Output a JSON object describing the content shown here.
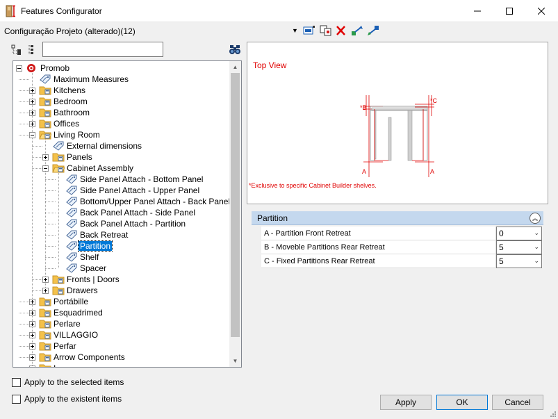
{
  "window": {
    "title": "Features Configurator",
    "minimize_icon": "minimize-icon",
    "maximize_icon": "maximize-icon",
    "close_icon": "close-icon"
  },
  "project": {
    "name": "Configuração Projeto (alterado)(12)",
    "toolbar_icons": [
      "project-dropdown-icon",
      "edit-project-icon",
      "copy-project-icon",
      "delete-icon",
      "export-icon",
      "import-icon"
    ]
  },
  "search": {
    "value": "",
    "placeholder": ""
  },
  "tree": {
    "items": [
      {
        "label": "Promob",
        "icon": "promob-logo-icon"
      },
      {
        "label": "Maximum Measures",
        "icon": "tag-icon"
      },
      {
        "label": "Kitchens",
        "icon": "folder-icon"
      },
      {
        "label": "Bedroom",
        "icon": "folder-icon"
      },
      {
        "label": "Bathroom",
        "icon": "folder-icon"
      },
      {
        "label": "Offices",
        "icon": "folder-icon"
      },
      {
        "label": "Living Room",
        "icon": "folder-open-icon"
      },
      {
        "label": "External dimensions",
        "icon": "tag-icon"
      },
      {
        "label": "Panels",
        "icon": "folder-icon"
      },
      {
        "label": "Cabinet Assembly",
        "icon": "folder-open-icon"
      },
      {
        "label": "Side Panel Attach - Bottom Panel",
        "icon": "tag-icon"
      },
      {
        "label": " Side Panel Attach - Upper Panel",
        "icon": "tag-icon"
      },
      {
        "label": " Bottom/Upper Panel Attach - Back Panel",
        "icon": "tag-icon"
      },
      {
        "label": "Back Panel Attach - Side Panel",
        "icon": "tag-icon"
      },
      {
        "label": "Back Panel Attach - Partition",
        "icon": "tag-icon"
      },
      {
        "label": "Back Retreat",
        "icon": "tag-icon"
      },
      {
        "label": "Partition",
        "icon": "tag-icon"
      },
      {
        "label": "Shelf",
        "icon": "tag-icon"
      },
      {
        "label": " Spacer",
        "icon": "tag-icon"
      },
      {
        "label": "Fronts | Doors",
        "icon": "folder-icon"
      },
      {
        "label": "Drawers",
        "icon": "folder-icon"
      },
      {
        "label": "Portábille",
        "icon": "folder-icon"
      },
      {
        "label": "Esquadrimed",
        "icon": "folder-icon"
      },
      {
        "label": "Perlare",
        "icon": "folder-icon"
      },
      {
        "label": "VILLAGGIO",
        "icon": "folder-icon"
      },
      {
        "label": "Perfar",
        "icon": "folder-icon"
      },
      {
        "label": "Arrow Components",
        "icon": "folder-icon"
      },
      {
        "label": "I",
        "icon": "folder-icon"
      }
    ]
  },
  "preview": {
    "title": "Top View",
    "note": "*Exclusive to specific Cabinet Builder shelves.",
    "marker_a_left": "A",
    "marker_a_right": "A",
    "marker_b": "*B",
    "marker_c": "*C"
  },
  "properties": {
    "group": "Partition",
    "rows": [
      {
        "name": "A - Partition Front Retreat",
        "value": "0"
      },
      {
        "name": "B - Moveble Partitions Rear Retreat",
        "value": "5"
      },
      {
        "name": "C - Fixed Partitions Rear Retreat",
        "value": "5"
      }
    ]
  },
  "options": {
    "apply_selected": "Apply to the selected items",
    "apply_existent": "Apply to the existent items"
  },
  "buttons": {
    "apply": "Apply",
    "ok": "OK",
    "cancel": "Cancel"
  },
  "colors": {
    "selection": "#0078d7",
    "accent_red": "#e00000",
    "group_header": "#c4d8ee"
  }
}
